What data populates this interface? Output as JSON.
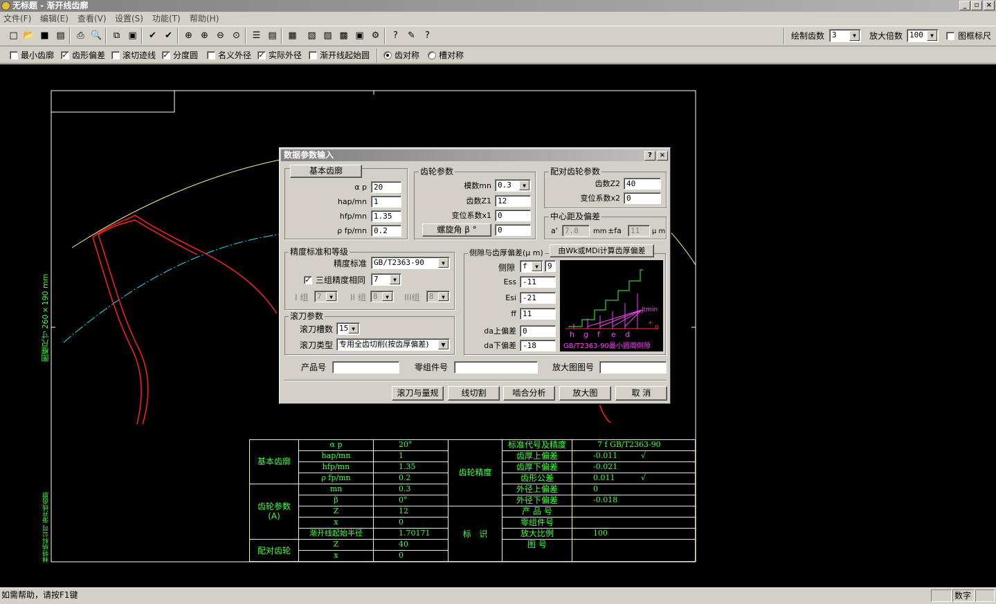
{
  "window": {
    "title": "无标题 - 渐开线齿廓",
    "min": "_",
    "restore": "▫",
    "close": "×"
  },
  "menu": [
    "文件(F)",
    "编辑(E)",
    "查看(V)",
    "设置(S)",
    "功能(T)",
    "帮助(H)"
  ],
  "toolbar": {
    "icons": [
      "new-file-icon",
      "open-folder-icon",
      "save-icon",
      "save-as-icon",
      "print-icon",
      "print-preview-icon",
      "frame-icon",
      "frame-alt-icon",
      "checkmark-icon",
      "checkmark-alt-icon",
      "zoom-window-icon",
      "zoom-in-icon",
      "zoom-out-icon",
      "zoom-fit-icon",
      "tool-a-icon",
      "tool-b-icon",
      "calculator-icon",
      "chart-icon",
      "table-icon",
      "export-icon",
      "image-icon",
      "settings-icon",
      "help-pointer-icon",
      "about-icon",
      "question-icon"
    ],
    "glyphs": [
      "□",
      "📂",
      "■",
      "▤",
      "⎙",
      "🔍",
      "⧉",
      "▣",
      "✔",
      "✔",
      "⊕",
      "⊕",
      "⊖",
      "⊙",
      "☰",
      "▤",
      "▦",
      "▧",
      "▨",
      "▩",
      "▣",
      "⚙",
      "?",
      "✎",
      "?"
    ],
    "teeth_label": "绘制齿数",
    "teeth_value": "3",
    "scale_label": "放大倍数",
    "scale_value": "100",
    "ruler_label": "图框标尺"
  },
  "options": [
    {
      "label": "最小齿廓",
      "checked": false
    },
    {
      "label": "齿形偏差",
      "checked": true
    },
    {
      "label": "滚切迹线",
      "checked": false
    },
    {
      "label": "分度圆",
      "checked": true
    },
    {
      "label": "名义外径",
      "checked": false
    },
    {
      "label": "实际外径",
      "checked": true
    },
    {
      "label": "渐开线起始圆",
      "checked": false
    }
  ],
  "radios": [
    {
      "label": "齿对称",
      "checked": true
    },
    {
      "label": "槽对称",
      "checked": false
    }
  ],
  "drawing": {
    "frame_size_label": "图框尺寸 260×190 mm",
    "company_label": "林特纳科公司 渐开线齿廓"
  },
  "dialog": {
    "title": "数据参数输入",
    "help": "?",
    "close": "×",
    "basic": {
      "button": "基本齿廓",
      "rows": [
        {
          "label": "α p",
          "value": "20"
        },
        {
          "label": "hap/mn",
          "value": "1"
        },
        {
          "label": "hfp/mn",
          "value": "1.35"
        },
        {
          "label": "ρ fp/mn",
          "value": "0.2"
        }
      ]
    },
    "gear": {
      "title": "齿轮参数",
      "module_label": "模数mn",
      "module_value": "0.3",
      "z1_label": "齿数Z1",
      "z1_value": "12",
      "x1_label": "变位系数x1",
      "x1_value": "0",
      "helix_button": "螺旋角 β °",
      "helix_value": "0"
    },
    "mate": {
      "title": "配对齿轮参数",
      "z2_label": "齿数Z2",
      "z2_value": "40",
      "x2_label": "变位系数x2",
      "x2_value": "0"
    },
    "center": {
      "title": "中心距及偏差",
      "a_label": "a'",
      "a_value": "7.8",
      "mm": "mm",
      "fa_label": "±fa",
      "fa_value": "11",
      "um": "μ m"
    },
    "accuracy": {
      "title": "精度标准和等级",
      "std_label": "精度标准",
      "std_value": "GB/T2363-90",
      "same_label": "三组精度相同",
      "same_checked": true,
      "same_value": "7",
      "g1_label": "I 组",
      "g1_value": "7",
      "g2_label": "II 组",
      "g2_value": "8",
      "g3_label": "III组",
      "g3_value": "8"
    },
    "hob": {
      "title": "滚刀参数",
      "slots_label": "滚刀槽数",
      "slots_value": "15",
      "type_label": "滚刀类型",
      "type_value": "专用全齿切削(按齿厚偏差)"
    },
    "backlash": {
      "title": "侧隙与齿厚偏差(μ m)",
      "calc_button": "由Wk或MDi计算齿厚偏差",
      "side_label": "侧隙",
      "side_value": "f",
      "side_extra": "9",
      "ess_label": "Ess",
      "ess_value": "-11",
      "esi_label": "Esi",
      "esi_value": "-21",
      "ff_label": "ff",
      "ff_value": "11",
      "da_up_label": "da上偏差",
      "da_up_value": "0",
      "da_low_label": "da下偏差",
      "da_low_value": "-18",
      "diagram": {
        "jtmin": "Jtmin",
        "zero": "0",
        "plus": "+",
        "letters": [
          "h",
          "g",
          "f",
          "e",
          "d"
        ],
        "caption": "GB/T2363-90最小圆周侧隙"
      }
    },
    "product_label": "产品号",
    "part_label": "零组件号",
    "enlarge_label": "放大图图号",
    "buttons": [
      "滚刀与量规",
      "线切割",
      "啮合分析",
      "放大图",
      "取  消"
    ]
  },
  "table": {
    "left_groups": [
      "基本齿廓",
      "齿轮参数\n(A)",
      "配对齿轮"
    ],
    "left_rows": [
      {
        "k": "α p",
        "v": "20°"
      },
      {
        "k": "hap/mn",
        "v": "1"
      },
      {
        "k": "hfp/mn",
        "v": "1.35"
      },
      {
        "k": "ρ fp/mn",
        "v": "0.2"
      },
      {
        "k": "mn",
        "v": "0.3"
      },
      {
        "k": "β",
        "v": "0°"
      },
      {
        "k": "Z",
        "v": "12"
      },
      {
        "k": "x",
        "v": "0"
      },
      {
        "k": "渐开线起始半径",
        "v": "1.70171"
      },
      {
        "k": "Z",
        "v": "40"
      },
      {
        "k": "x",
        "v": "0"
      }
    ],
    "right_groups": [
      "齿轮精度",
      "标   识"
    ],
    "right_rows": [
      {
        "k": "标准代号及精度",
        "v": "7 f GB/T2363-90"
      },
      {
        "k": "齿厚上偏差",
        "v": "-0.011",
        "m": "√"
      },
      {
        "k": "齿厚下偏差",
        "v": "-0.021"
      },
      {
        "k": "齿形公差",
        "v": "0.011",
        "m": "√"
      },
      {
        "k": "外径上偏差",
        "v": "0"
      },
      {
        "k": "外径下偏差",
        "v": "-0.018"
      },
      {
        "k": "产 品 号",
        "v": ""
      },
      {
        "k": "零组件号",
        "v": ""
      },
      {
        "k": "放大比例",
        "v": "100"
      },
      {
        "k": "图    号",
        "v": ""
      }
    ]
  },
  "status": {
    "help": "如需帮助，请按F1键",
    "mode": "数字"
  },
  "colors": {
    "table_line": "#ffff60",
    "table_text": "#40ff40",
    "gear_red": "#ff2020",
    "circle_cyan": "#20e0ff",
    "circle_yellow": "#ffff80",
    "diagram_magenta": "#ff40ff"
  }
}
